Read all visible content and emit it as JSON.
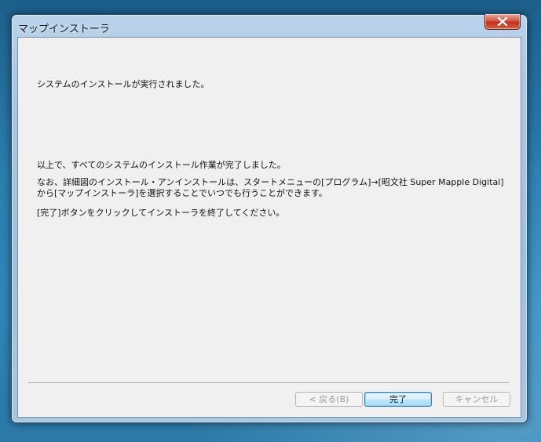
{
  "window": {
    "title": "マップインストーラ",
    "close_icon": "close-icon"
  },
  "content": {
    "line1": "システムのインストールが実行されました。",
    "line2": "以上で、すべてのシステムのインストール作業が完了しました。",
    "line3": "なお、詳細図のインストール・アンインストールは、スタートメニューの[プログラム]→[昭文社 Super Mapple Digital]から[マップインストーラ]を選択することでいつでも行うことができます。",
    "line4": "[完了]ボタンをクリックしてインストーラを終了してください。"
  },
  "buttons": {
    "back": "< 戻る(B)",
    "finish": "完了",
    "cancel": "キャンセル"
  }
}
